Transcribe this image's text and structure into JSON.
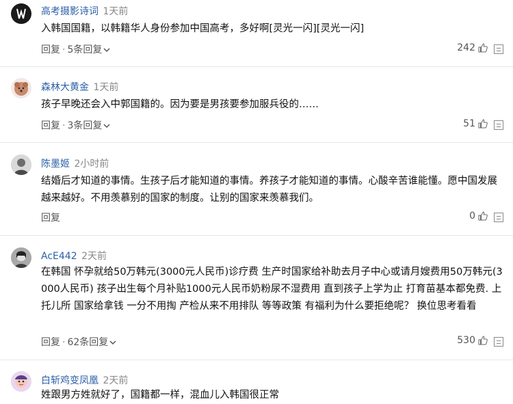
{
  "comments": [
    {
      "user": "高考摄影诗词",
      "time": "1天前",
      "text": "入韩国国籍，以韩籍华人身份参加中国高考，多好啊[灵光一闪][灵光一闪]",
      "reply_label": "回复",
      "sep": "·",
      "replies": "5条回复",
      "likes": "242",
      "avatar_icon": "logo-avatar-icon"
    },
    {
      "user": "森林大黄金",
      "time": "1天前",
      "text": "孩子早晚还会入中郭国籍的。因为要是男孩要参加服兵役的……",
      "reply_label": "回复",
      "sep": "·",
      "replies": "3条回复",
      "likes": "51",
      "avatar_icon": "dog-avatar-icon"
    },
    {
      "user": "陈墨姬",
      "time": "2小时前",
      "text": "结婚后才知道的事情。生孩子后才能知道的事情。养孩子才能知道的事情。心酸辛苦谁能懂。愿中国发展越来越好。不用羡慕别的国家的制度。让别的国家来羡慕我们。",
      "reply_label": "回复",
      "likes": "0",
      "avatar_icon": "person-avatar-icon"
    },
    {
      "user": "AcE442",
      "time": "2天前",
      "text": "在韩国 怀孕就给50万韩元(3000元人民币)诊疗费 生产时国家给补助去月子中心或请月嫂费用50万韩元(3000人民币) 孩子出生每个月补贴1000元人民币奶粉尿不湿费用 直到孩子上学为止 打育苗基本都免费. 上托儿所 国家给拿钱 一分不用掏 产检从来不用排队 等等政策 有福利为什么要拒绝呢？ 换位思考看看",
      "reply_label": "回复",
      "sep": "·",
      "replies": "62条回复",
      "likes": "530",
      "avatar_icon": "portrait-avatar-icon"
    },
    {
      "user": "白斩鸡变凤凰",
      "time": "2天前",
      "text": "姓跟男方姓就好了，国籍都一样，混血儿入韩国很正常",
      "avatar_icon": "cartoon-avatar-icon"
    }
  ]
}
